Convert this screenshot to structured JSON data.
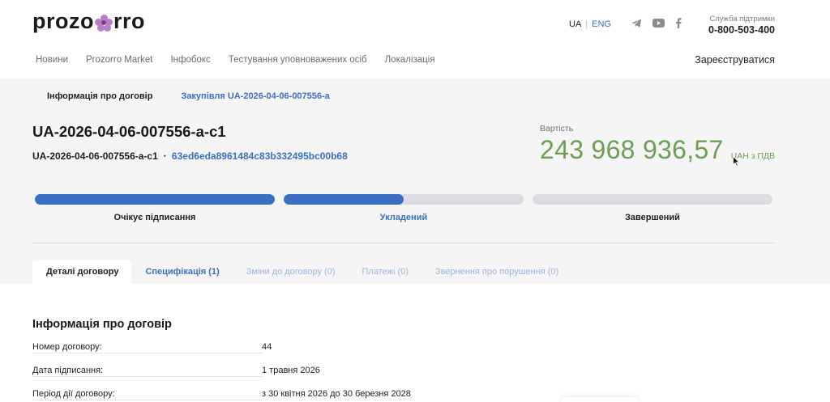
{
  "header": {
    "logo_left": "prozo",
    "logo_right": "rro",
    "lang_ua": "UA",
    "lang_sep": "|",
    "lang_eng": "ENG",
    "support_label": "Служба підтримки",
    "support_phone": "0-800-503-400",
    "socials": [
      "telegram-icon",
      "youtube-icon",
      "facebook-icon"
    ]
  },
  "nav": {
    "items": [
      "Новини",
      "Prozorro Market",
      "Інфобокс",
      "Тестування уповноважених осіб",
      "Локалізація"
    ],
    "register": "Зареєструватися"
  },
  "breadcrumb": {
    "current": "Інформація про договір",
    "procurement": "Закупівля UA-2026-04-06-007556-a"
  },
  "contract": {
    "title": "UA-2026-04-06-007556-a-c1",
    "id": "UA-2026-04-06-007556-a-c1",
    "dot": "•",
    "hash": "63ed6eda8961484c83b332495bc00b68",
    "price_label": "Вартість",
    "price_amount": "243 968 936,57",
    "price_currency": "UAH з ПДВ"
  },
  "status": {
    "steps": [
      {
        "label": "Очікує підписання",
        "progress": 1.0
      },
      {
        "label": "Укладений",
        "progress": 0.5
      },
      {
        "label": "Завершений",
        "progress": 0.0
      }
    ]
  },
  "tabs": {
    "details": "Деталі договору",
    "spec": "Специфікація (1)",
    "changes": "Зміни до договору (0)",
    "payments": "Платежі (0)",
    "violations": "Звернення про порушення (0)"
  },
  "details": {
    "title": "Інформація про договір",
    "rows": [
      {
        "key": "Номер договору:",
        "value": "44"
      },
      {
        "key": "Дата підписання:",
        "value": "1 травня 2026"
      },
      {
        "key": "Період дії договору:",
        "value": "з 30 квітня 2026 до 30 березня 2028"
      }
    ]
  },
  "colors": {
    "accent_blue": "#3a6fc4",
    "price_green": "#6a9f55",
    "logo_flower": "#b77fc8"
  }
}
